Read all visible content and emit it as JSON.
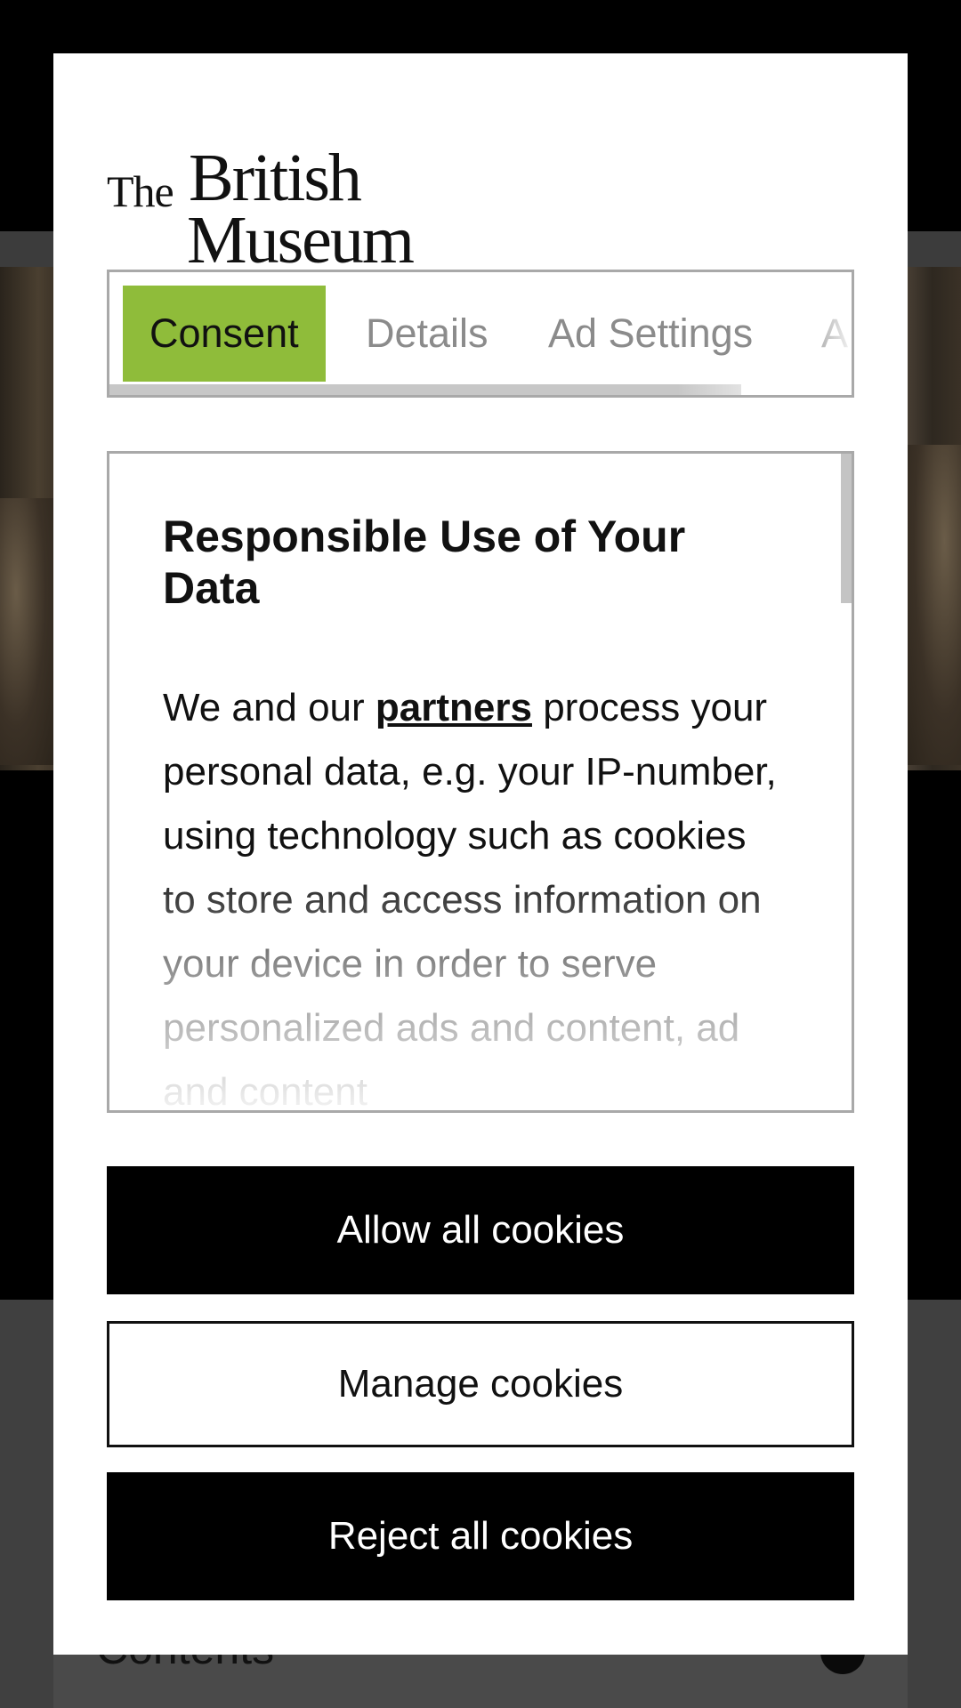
{
  "background": {
    "contents_label": "Contents"
  },
  "logo": {
    "the": "The",
    "british": "British",
    "museum": "Museum"
  },
  "tabs": [
    {
      "label": "Consent",
      "active": true
    },
    {
      "label": "Details",
      "active": false
    },
    {
      "label": "Ad Settings",
      "active": false
    },
    {
      "label": "A",
      "active": false
    }
  ],
  "content": {
    "heading": "Responsible Use of Your Data",
    "body_prefix": "We and our ",
    "partners_link": "partners",
    "body_suffix": " process your personal data, e.g. your IP-number, using technology such as cookies to store and access information on your device in order to serve personalized ads and content, ad and content"
  },
  "buttons": {
    "allow": "Allow all cookies",
    "manage": "Manage cookies",
    "reject": "Reject all cookies"
  },
  "colors": {
    "active_tab": "#8fbc3a",
    "primary_button": "#000000"
  }
}
